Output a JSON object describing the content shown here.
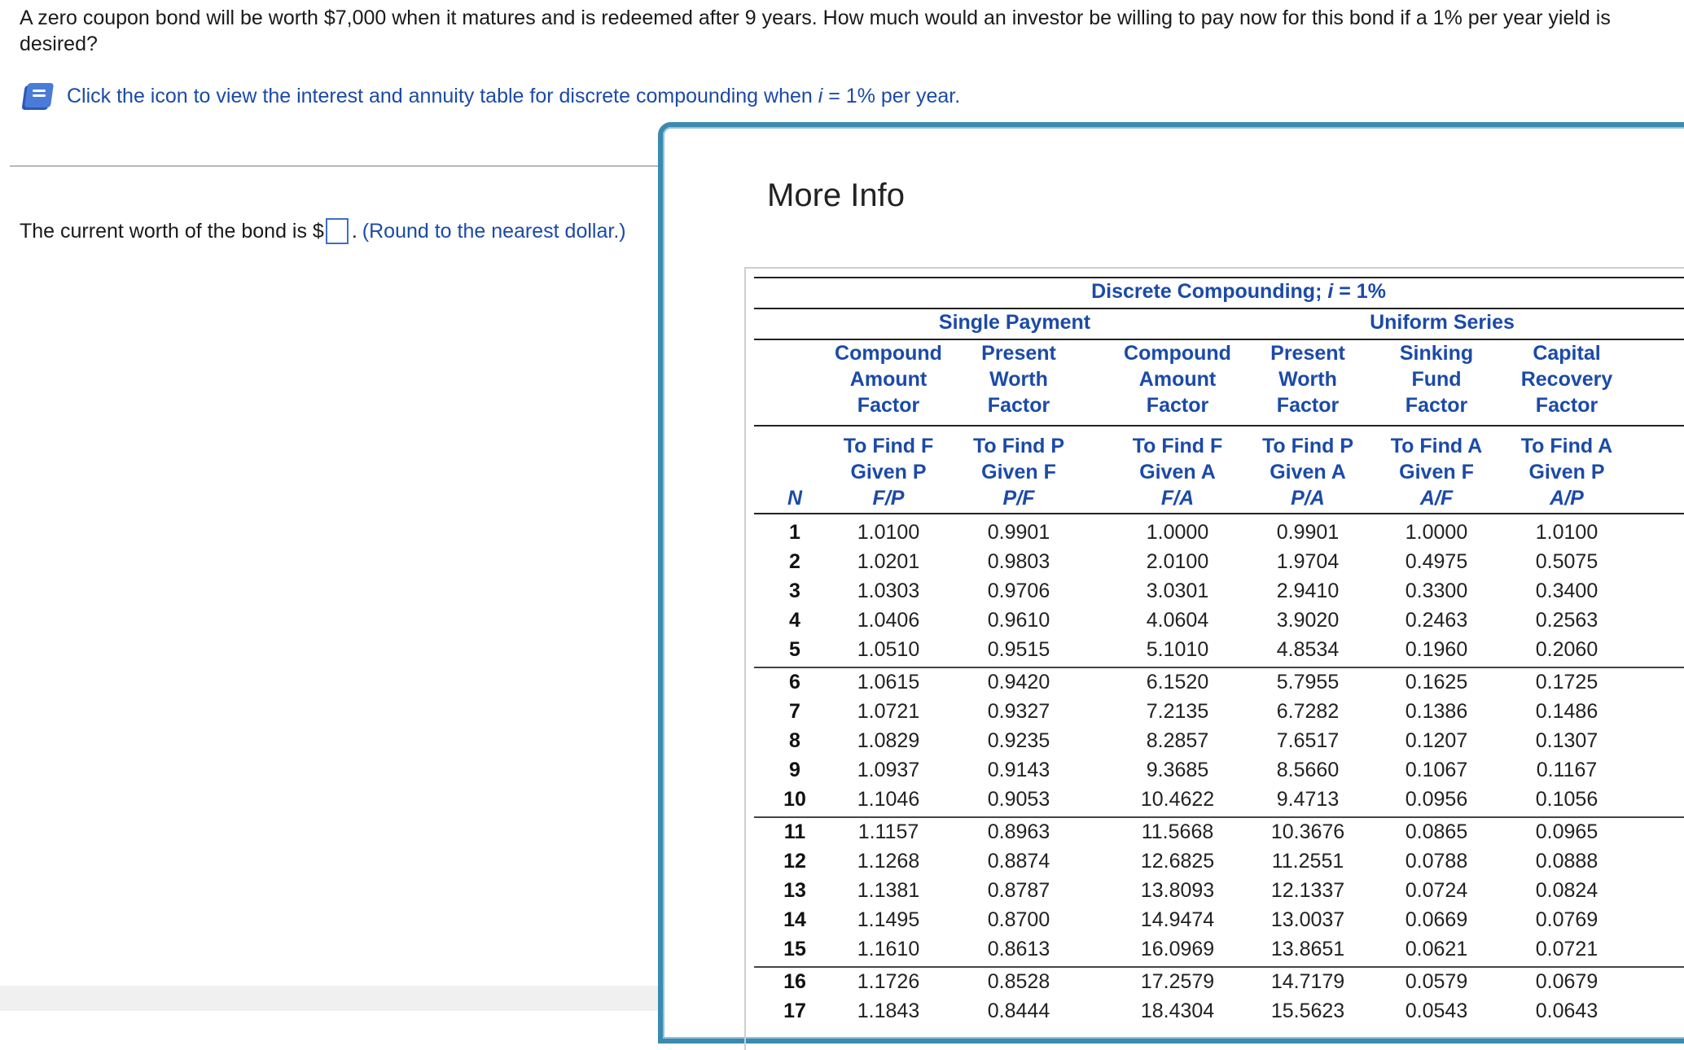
{
  "question": "A zero coupon bond will be worth $7,000 when it matures and is redeemed after 9 years. How much would an investor be willing to pay now for this bond if a 1% per year yield is desired?",
  "hint": {
    "icon": "book-icon",
    "text_before": "Click the icon to view the interest and annuity table for discrete compounding when ",
    "i_symbol": "i",
    "text_after": " = 1% per year."
  },
  "answer": {
    "prefix": "The current worth of the bond is $",
    "suffix": ".",
    "note": "(Round to the nearest dollar.)",
    "input_value": ""
  },
  "modal": {
    "title": "More Info",
    "table": {
      "caption_prefix": "Discrete Compounding; ",
      "caption_i": "i",
      "caption_suffix": " = 1%",
      "group_single": "Single Payment",
      "group_uniform": "Uniform Series",
      "n_header": "N",
      "columns": [
        {
          "name": [
            "Compound",
            "Amount",
            "Factor"
          ],
          "find": [
            "To Find F",
            "Given P"
          ],
          "sym": "F/P"
        },
        {
          "name": [
            "Present",
            "Worth",
            "Factor"
          ],
          "find": [
            "To Find P",
            "Given F"
          ],
          "sym": "P/F"
        },
        {
          "name": [
            "Compound",
            "Amount",
            "Factor"
          ],
          "find": [
            "To Find F",
            "Given A"
          ],
          "sym": "F/A"
        },
        {
          "name": [
            "Present",
            "Worth",
            "Factor"
          ],
          "find": [
            "To Find P",
            "Given A"
          ],
          "sym": "P/A"
        },
        {
          "name": [
            "Sinking",
            "Fund",
            "Factor"
          ],
          "find": [
            "To Find A",
            "Given F"
          ],
          "sym": "A/F"
        },
        {
          "name": [
            "Capital",
            "Recovery",
            "Factor"
          ],
          "find": [
            "To Find A",
            "Given P"
          ],
          "sym": "A/P"
        }
      ],
      "rows": [
        [
          "1",
          "1.0100",
          "0.9901",
          "1.0000",
          "0.9901",
          "1.0000",
          "1.0100"
        ],
        [
          "2",
          "1.0201",
          "0.9803",
          "2.0100",
          "1.9704",
          "0.4975",
          "0.5075"
        ],
        [
          "3",
          "1.0303",
          "0.9706",
          "3.0301",
          "2.9410",
          "0.3300",
          "0.3400"
        ],
        [
          "4",
          "1.0406",
          "0.9610",
          "4.0604",
          "3.9020",
          "0.2463",
          "0.2563"
        ],
        [
          "5",
          "1.0510",
          "0.9515",
          "5.1010",
          "4.8534",
          "0.1960",
          "0.2060"
        ],
        [
          "6",
          "1.0615",
          "0.9420",
          "6.1520",
          "5.7955",
          "0.1625",
          "0.1725"
        ],
        [
          "7",
          "1.0721",
          "0.9327",
          "7.2135",
          "6.7282",
          "0.1386",
          "0.1486"
        ],
        [
          "8",
          "1.0829",
          "0.9235",
          "8.2857",
          "7.6517",
          "0.1207",
          "0.1307"
        ],
        [
          "9",
          "1.0937",
          "0.9143",
          "9.3685",
          "8.5660",
          "0.1067",
          "0.1167"
        ],
        [
          "10",
          "1.1046",
          "0.9053",
          "10.4622",
          "9.4713",
          "0.0956",
          "0.1056"
        ],
        [
          "11",
          "1.1157",
          "0.8963",
          "11.5668",
          "10.3676",
          "0.0865",
          "0.0965"
        ],
        [
          "12",
          "1.1268",
          "0.8874",
          "12.6825",
          "11.2551",
          "0.0788",
          "0.0888"
        ],
        [
          "13",
          "1.1381",
          "0.8787",
          "13.8093",
          "12.1337",
          "0.0724",
          "0.0824"
        ],
        [
          "14",
          "1.1495",
          "0.8700",
          "14.9474",
          "13.0037",
          "0.0669",
          "0.0769"
        ],
        [
          "15",
          "1.1610",
          "0.8613",
          "16.0969",
          "13.8651",
          "0.0621",
          "0.0721"
        ],
        [
          "16",
          "1.1726",
          "0.8528",
          "17.2579",
          "14.7179",
          "0.0579",
          "0.0679"
        ],
        [
          "17",
          "1.1843",
          "0.8444",
          "18.4304",
          "15.5623",
          "0.0543",
          "0.0643"
        ]
      ]
    }
  }
}
